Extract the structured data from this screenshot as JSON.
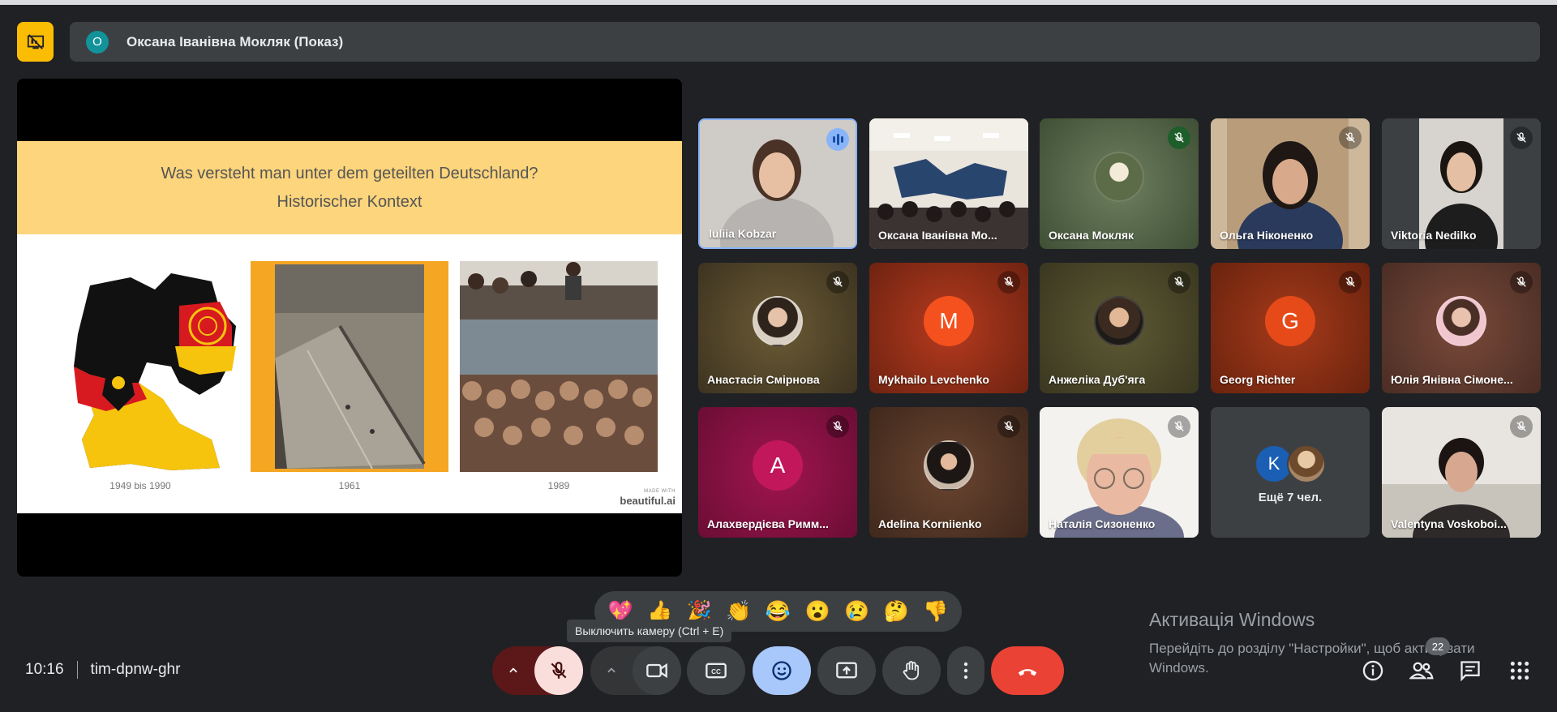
{
  "header": {
    "presenter_initial": "О",
    "presenter_title": "Оксана Іванівна Мокляк (Показ)"
  },
  "slide": {
    "title": "Was versteht man unter dem geteilten Deutschland?",
    "subtitle": "Historischer Kontext",
    "captions": [
      "1949 bis 1990",
      "1961",
      "1989"
    ],
    "made_with": "MADE WITH",
    "brand": "beautiful.ai"
  },
  "participants": [
    {
      "name": "Iuliia Kobzar",
      "status": "speaking"
    },
    {
      "name": "Оксана Іванівна Мо...",
      "status": "none"
    },
    {
      "name": "Оксана Мокляк",
      "status": "muted"
    },
    {
      "name": "Ольга Ніконенко",
      "status": "muted"
    },
    {
      "name": "Viktoria Nedilko",
      "status": "muted"
    },
    {
      "name": "Анастасія Смірнова",
      "status": "muted"
    },
    {
      "name": "Mykhailo Levchenko",
      "status": "muted",
      "initial": "M"
    },
    {
      "name": "Анжеліка Дуб'яга",
      "status": "muted"
    },
    {
      "name": "Georg Richter",
      "status": "muted",
      "initial": "G"
    },
    {
      "name": "Юлія Янівна Сімоне...",
      "status": "muted"
    },
    {
      "name": "Алахвердієва Римм...",
      "status": "muted",
      "initial": "А"
    },
    {
      "name": "Adelina Korniienko",
      "status": "muted"
    },
    {
      "name": "Наталія Сизоненко",
      "status": "muted"
    },
    {
      "name": "Valentyna Voskoboi...",
      "status": "muted"
    }
  ],
  "more_tile": {
    "initial": "K",
    "label": "Ещё 7 чел."
  },
  "reactions": [
    "💖",
    "👍",
    "🎉",
    "👏",
    "😂",
    "😮",
    "😢",
    "🤔",
    "👎"
  ],
  "tooltip": "Выключить камеру (Ctrl + E)",
  "meeting": {
    "time": "10:16",
    "code": "tim-dpnw-ghr"
  },
  "watermark": {
    "title": "Активація Windows",
    "line1": "Перейдіть до розділу \"Настройки\", щоб активувати",
    "line2": "Windows."
  },
  "people_count": "22",
  "colors": {
    "accent": "#8ab4f8",
    "present": "#fbbc04",
    "leave": "#ea4335",
    "mic_off": "#f9dedc"
  }
}
